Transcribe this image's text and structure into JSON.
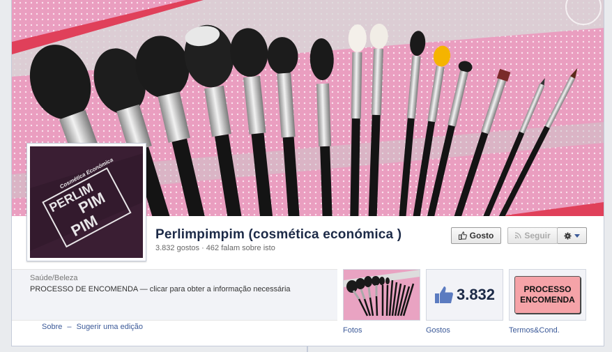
{
  "page": {
    "name": "Perlimpimpim (cosmética económica )",
    "likes_text": "3.832 gostos",
    "separator": "·",
    "talking_text": "462 falam sobre isto"
  },
  "actions": {
    "like_label": "Gosto",
    "follow_label": "Seguir"
  },
  "profile": {
    "logo_top": "Cosmética Económica",
    "logo_line1": "PERLIM",
    "logo_line2": "PIM",
    "logo_line3": "PIM"
  },
  "about": {
    "category": "Saúde/Beleza",
    "description": "PROCESSO DE ENCOMENDA — clicar para obter a informação necessária",
    "link_about": "Sobre",
    "link_separator": "–",
    "link_suggest": "Sugerir uma edição"
  },
  "tiles": {
    "photos_label": "Fotos",
    "likes_label": "Gostos",
    "likes_count": "3.832",
    "terms_label": "Termos&Cond.",
    "terms_line1": "PROCESSO",
    "terms_line2": "ENCOMENDA"
  },
  "colors": {
    "facebook_blue": "#3b5998",
    "name_color": "#1c2a47",
    "cover_pink": "#e9a3c2",
    "terms_pink": "#f5a3a8"
  },
  "icons": {
    "like": "thumbs-up-icon",
    "follow": "rss-icon",
    "gear": "gear-icon",
    "caret": "chevron-down-icon"
  }
}
